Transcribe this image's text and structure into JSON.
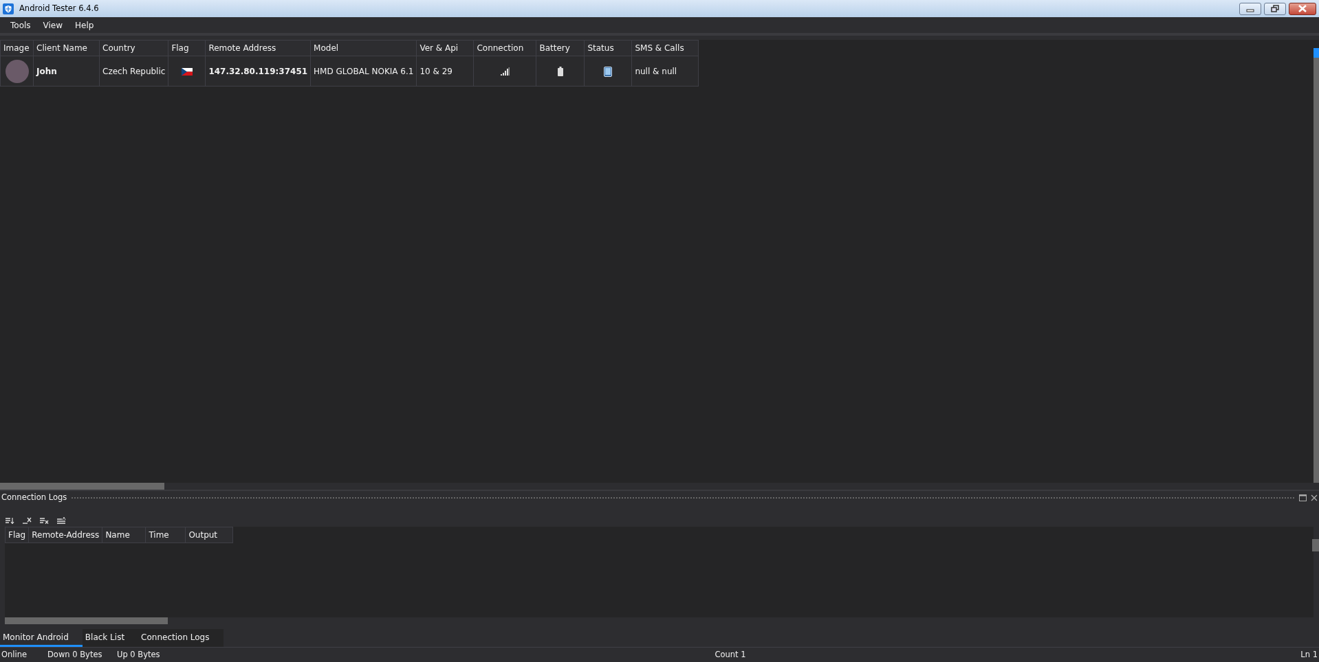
{
  "window": {
    "title": "Android Tester 6.4.6"
  },
  "menu": [
    "Tools",
    "View",
    "Help"
  ],
  "clients_table": {
    "columns": [
      "Image",
      "Client Name",
      "Country",
      "Flag",
      "Remote Address",
      "Model",
      "Ver & Api",
      "Connection",
      "Battery",
      "Status",
      "SMS & Calls"
    ],
    "rows": [
      {
        "client_name": "John",
        "country": "Czech Republic",
        "remote_address": "147.32.80.119:37451",
        "model": "HMD GLOBAL NOKIA 6.1",
        "ver_api": "10 & 29",
        "sms_calls": "null & null",
        "selected": false
      }
    ]
  },
  "log_panel": {
    "title": "Connection Logs",
    "columns": [
      "Flag",
      "Remote-Address",
      "Name",
      "Time",
      "Output"
    ]
  },
  "tabs": [
    {
      "label": "Monitor Android",
      "selected": true
    },
    {
      "label": "Black List",
      "selected": false
    },
    {
      "label": "Connection Logs",
      "selected": false
    }
  ],
  "status_bar": {
    "state": "Online",
    "down": "Down 0 Bytes",
    "up": "Up 0 Bytes",
    "count": "Count 1",
    "line": "Ln 1"
  }
}
